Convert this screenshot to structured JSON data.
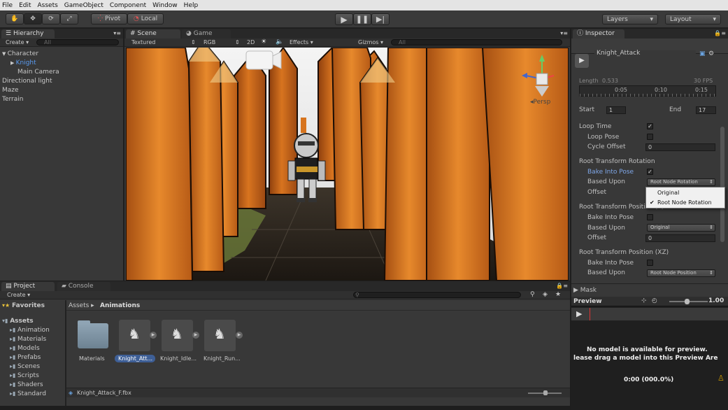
{
  "menu": [
    "File",
    "Edit",
    "Assets",
    "GameObject",
    "Component",
    "Window",
    "Help"
  ],
  "toolbar": {
    "pivot": "Pivot",
    "local": "Local",
    "layers": "Layers",
    "layout": "Layout"
  },
  "hierarchy": {
    "tab": "Hierarchy",
    "create": "Create",
    "search": "All",
    "items": [
      {
        "label": "Character",
        "indent": 0,
        "selected": false
      },
      {
        "label": "Knight",
        "indent": 1,
        "selected": true
      },
      {
        "label": "Main Camera",
        "indent": 2,
        "selected": false
      },
      {
        "label": "Directional light",
        "indent": 0,
        "selected": false
      },
      {
        "label": "Maze",
        "indent": 0,
        "selected": false
      },
      {
        "label": "Terrain",
        "indent": 0,
        "selected": false
      }
    ]
  },
  "scene": {
    "tab_scene": "Scene",
    "tab_game": "Game",
    "shading": "Textured",
    "render": "RGB",
    "twod": "2D",
    "effects": "Effects",
    "gizmos": "Gizmos",
    "search": "All",
    "persp": "Persp"
  },
  "project": {
    "tab": "Project",
    "console": "Console",
    "create": "Create",
    "breadcrumb_root": "Assets",
    "breadcrumb_current": "Animations",
    "tree": [
      {
        "label": "Favorites",
        "indent": 0
      },
      {
        "label": "Assets",
        "indent": 0
      },
      {
        "label": "Animation",
        "indent": 1
      },
      {
        "label": "Materials",
        "indent": 1
      },
      {
        "label": "Models",
        "indent": 1
      },
      {
        "label": "Prefabs",
        "indent": 1
      },
      {
        "label": "Scenes",
        "indent": 1
      },
      {
        "label": "Scripts",
        "indent": 1
      },
      {
        "label": "Shaders",
        "indent": 1
      },
      {
        "label": "Standard",
        "indent": 1
      }
    ],
    "assets": [
      "Materials",
      "Knight_Att...",
      "Knight_Idle...",
      "Knight_Run..."
    ],
    "status": "Knight_Attack_F.fbx"
  },
  "inspector": {
    "tab": "Inspector",
    "clip_name": "Knight_Attack",
    "length_label": "Length",
    "length_value": "0.533",
    "fps": "30 FPS",
    "ticks": [
      "0:05",
      "0:10",
      "0:15"
    ],
    "start_label": "Start",
    "start_value": "1",
    "end_label": "End",
    "end_value": "17",
    "loop_time": "Loop Time",
    "loop_pose": "Loop Pose",
    "cycle_offset": "Cycle Offset",
    "cycle_offset_value": "0",
    "rtr_header": "Root Transform Rotation",
    "bake_into_pose": "Bake Into Pose",
    "based_upon": "Based Upon",
    "rtr_based_value": "Root Node Rotation",
    "offset": "Offset",
    "dropdown_options": [
      "Original",
      "Root Node Rotation"
    ],
    "rtpy_header": "Root Transform Position (Y)",
    "rtpy_based_value": "Original",
    "rtpy_offset_value": "0",
    "rtpxz_header": "Root Transform Position (XZ)",
    "rtpxz_based_value": "Root Node Position",
    "mask": "Mask"
  },
  "preview": {
    "title": "Preview",
    "speed": "1.00",
    "message_line1": "No model is available for preview.",
    "message_line2": "lease drag a model into this Preview Are",
    "time": "0:00 (000.0%)"
  },
  "colors": {
    "accent_blue": "#3d82d6",
    "orange": "#d7741e",
    "select": "#3e5f96"
  }
}
